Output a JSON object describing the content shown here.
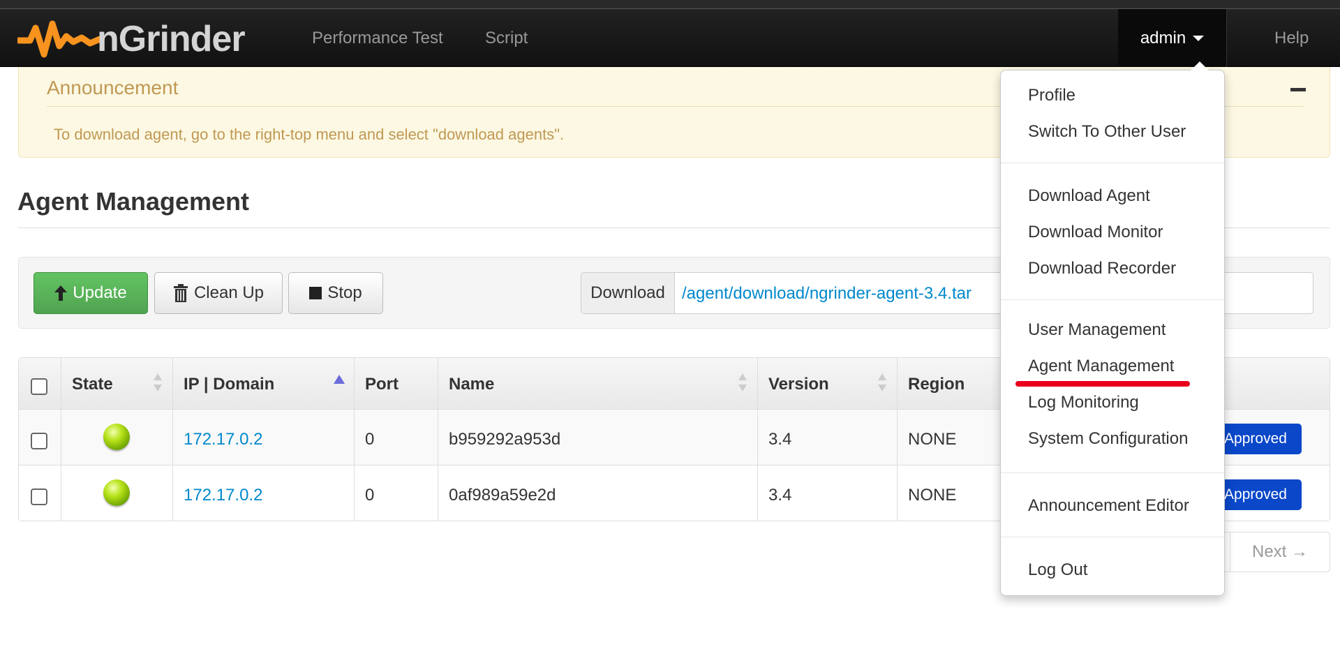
{
  "app": {
    "brand": "nGrinder"
  },
  "nav": {
    "items": [
      {
        "label": "Performance Test"
      },
      {
        "label": "Script"
      }
    ],
    "user": "admin",
    "help": "Help"
  },
  "announcement": {
    "title": "Announcement",
    "text": "To download agent, go to the right-top menu and select \"download agents\"."
  },
  "page": {
    "title": "Agent Management"
  },
  "toolbar": {
    "update_label": "Update",
    "cleanup_label": "Clean Up",
    "stop_label": "Stop",
    "download_label": "Download",
    "download_link": "/agent/download/ngrinder-agent-3.4.tar"
  },
  "table": {
    "headers": {
      "state": "State",
      "ip": "IP | Domain",
      "port": "Port",
      "name": "Name",
      "version": "Version",
      "region": "Region"
    },
    "rows": [
      {
        "state": "running",
        "ip": "172.17.0.2",
        "port": "0",
        "name": "b959292a953d",
        "version": "3.4",
        "region": "NONE",
        "approval": "Approved"
      },
      {
        "state": "running",
        "ip": "172.17.0.2",
        "port": "0",
        "name": "0af989a59e2d",
        "version": "3.4",
        "region": "NONE",
        "approval": "Approved"
      }
    ]
  },
  "pagination": {
    "next": "Next →"
  },
  "user_menu": {
    "items": [
      {
        "label": "Profile"
      },
      {
        "label": "Switch To Other User"
      },
      {
        "label": "Download Agent"
      },
      {
        "label": "Download Monitor"
      },
      {
        "label": "Download Recorder"
      },
      {
        "label": "User Management"
      },
      {
        "label": "Agent Management"
      },
      {
        "label": "Log Monitoring"
      },
      {
        "label": "System Configuration"
      },
      {
        "label": "Announcement Editor"
      },
      {
        "label": "Log Out"
      }
    ]
  },
  "colors": {
    "brand_orange": "#f7931e",
    "update_green": "#5bb75b",
    "approved_blue": "#0a47c9",
    "highlight_red": "#e8001c",
    "link": "#0088cc"
  }
}
